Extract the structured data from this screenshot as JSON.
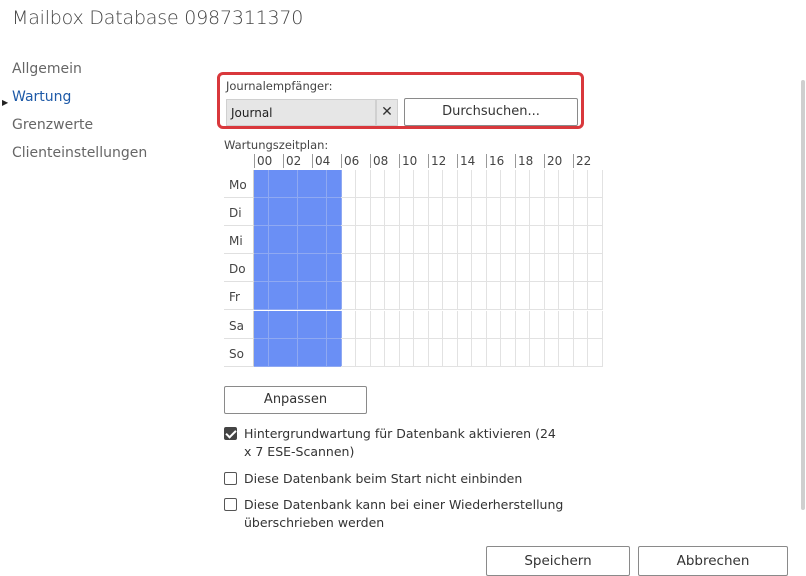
{
  "title": "Mailbox Database 0987311370",
  "nav": [
    {
      "label": "Allgemein",
      "active": false
    },
    {
      "label": "Wartung",
      "active": true
    },
    {
      "label": "Grenzwerte",
      "active": false
    },
    {
      "label": "Clienteinstellungen",
      "active": false
    }
  ],
  "journal": {
    "label": "Journalempfänger:",
    "value": "Journal",
    "clear_symbol": "✕",
    "browse_label": "Durchsuchen..."
  },
  "schedule": {
    "label": "Wartungszeitplan:",
    "hours": [
      "00",
      "02",
      "04",
      "06",
      "08",
      "10",
      "12",
      "14",
      "16",
      "18",
      "20",
      "22"
    ],
    "days": [
      "Mo",
      "Di",
      "Mi",
      "Do",
      "Fr",
      "Sa",
      "So"
    ],
    "active_hours": [
      0,
      1,
      2,
      3,
      4,
      5
    ],
    "active_color": "#6a8ff5"
  },
  "adjust_label": "Anpassen",
  "options": [
    {
      "lines": [
        "Hintergrundwartung für Datenbank aktivieren (24",
        "x 7 ESE-Scannen)"
      ],
      "checked": true
    },
    {
      "lines": [
        "Diese Datenbank beim Start nicht einbinden"
      ],
      "checked": false
    },
    {
      "lines": [
        "Diese Datenbank kann bei einer Wiederherstellung",
        "überschrieben werden"
      ],
      "checked": false
    }
  ],
  "footer": {
    "save_label": "Speichern",
    "cancel_label": "Abbrechen"
  },
  "colors": {
    "accent_nav": "#1e5aa8",
    "highlight_border": "#d9383c"
  }
}
